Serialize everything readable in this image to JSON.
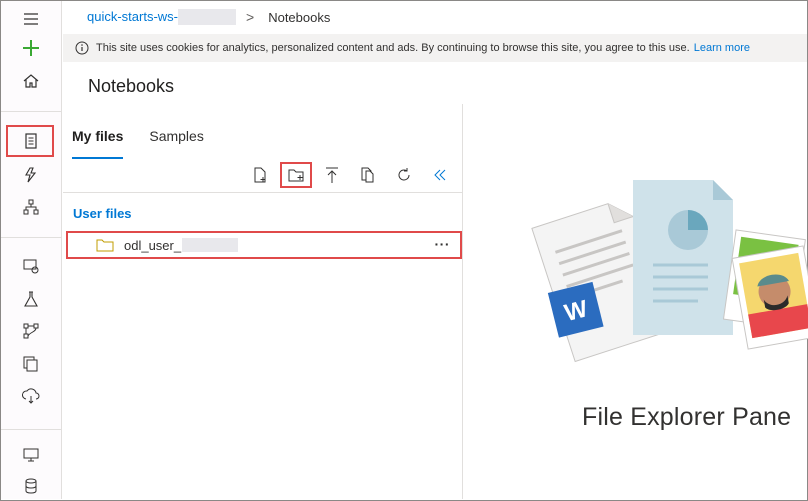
{
  "breadcrumb": {
    "workspace": "quick-starts-ws-",
    "separator": ">",
    "current": "Notebooks"
  },
  "cookie_banner": {
    "text": "This site uses cookies for analytics, personalized content and ads. By continuing to browse this site, you agree to this use.",
    "link": "Learn more"
  },
  "page": {
    "title": "Notebooks"
  },
  "tabs": [
    {
      "label": "My files",
      "active": true
    },
    {
      "label": "Samples",
      "active": false
    }
  ],
  "toolbar": {
    "buttons": [
      "new-file-icon",
      "new-folder-icon",
      "upload-icon",
      "duplicate-icon",
      "refresh-icon",
      "collapse-icon"
    ]
  },
  "files": {
    "section_label": "User files",
    "items": [
      {
        "name": "odl_user_",
        "more": "···"
      }
    ]
  },
  "right_pane": {
    "label": "File Explorer Pane"
  },
  "rail": {
    "icons": [
      "hamburger-icon",
      "add-icon",
      "home-icon",
      "notebook-icon",
      "automl-icon",
      "designer-icon",
      "datasets-icon",
      "experiments-icon",
      "pipelines-icon",
      "models-icon",
      "endpoints-icon",
      "compute-icon",
      "datastores-icon"
    ]
  },
  "colors": {
    "accent": "#0078d4",
    "highlight": "#e04a4a",
    "add": "#3aa833"
  }
}
